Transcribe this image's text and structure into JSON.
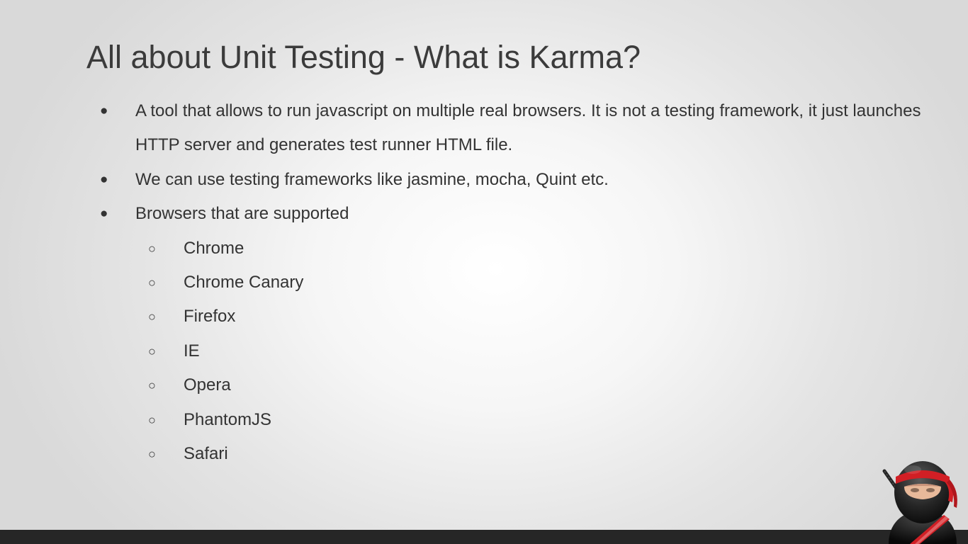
{
  "slide": {
    "title": "All about Unit Testing - What is Karma?",
    "bullets": [
      {
        "marker": "●",
        "text": "A tool that allows to run javascript on multiple real browsers. It is not a testing framework, it just launches HTTP server and generates test runner HTML file."
      },
      {
        "marker": "●",
        "text": "We can use testing frameworks like jasmine, mocha, Quint etc."
      },
      {
        "marker": "●",
        "text": "Browsers that are supported"
      }
    ],
    "sub_marker": "○",
    "browsers": [
      "Chrome",
      "Chrome Canary",
      "Firefox",
      "IE",
      "Opera",
      "PhantomJS",
      "Safari"
    ]
  },
  "colors": {
    "text": "#333333",
    "footer_bar": "#262626",
    "ninja_headband": "#d11f25"
  },
  "icons": {
    "logo": "ninja-mascot-icon"
  }
}
